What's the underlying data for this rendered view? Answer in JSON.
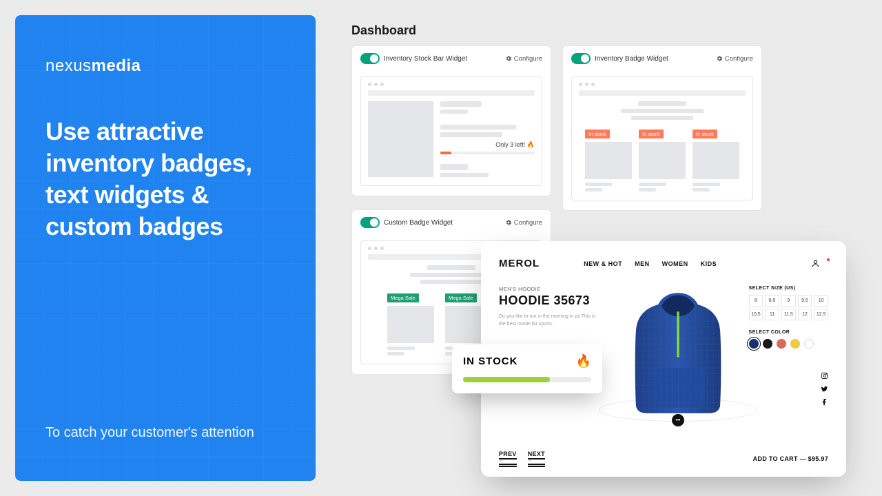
{
  "left": {
    "logo_light": "nexus",
    "logo_bold": "media",
    "headline": "Use attractive inventory badges, text widgets & custom badges",
    "subline": "To catch your customer's attention"
  },
  "dashboard_title": "Dashboard",
  "widgets": {
    "stockbar": {
      "title": "Inventory Stock Bar Widget",
      "configure": "Configure",
      "note": "Only 3 left! 🔥"
    },
    "invbadge": {
      "title": "Inventory Badge Widget",
      "configure": "Configure",
      "badge": "In stock"
    },
    "custom": {
      "title": "Custom Badge Widget",
      "configure": "Configure",
      "badge": "Mega Sale"
    }
  },
  "store": {
    "logo": "MEROL",
    "nav": [
      "NEW & HOT",
      "MEN",
      "WOMEN",
      "KIDS"
    ],
    "category": "MEN'S HOODIE",
    "product_title": "HOODIE 35673",
    "description": "Do you like to run in the morning in pa This is the best model for sports.",
    "instock": {
      "label": "IN STOCK",
      "emoji": "🔥"
    },
    "size_label": "SELECT SIZE (US)",
    "sizes": [
      "8",
      "8.5",
      "9",
      "9.5",
      "10",
      "10.5",
      "11",
      "11.5",
      "12",
      "12.5"
    ],
    "color_label": "SELECT COLOR",
    "colors": [
      "#15316f",
      "#1a1a1a",
      "#d86b5d",
      "#f3c948",
      "#ffffff"
    ],
    "prev": "PREV",
    "next": "NEXT",
    "add_to_cart": "ADD TO CART — $95.97"
  }
}
